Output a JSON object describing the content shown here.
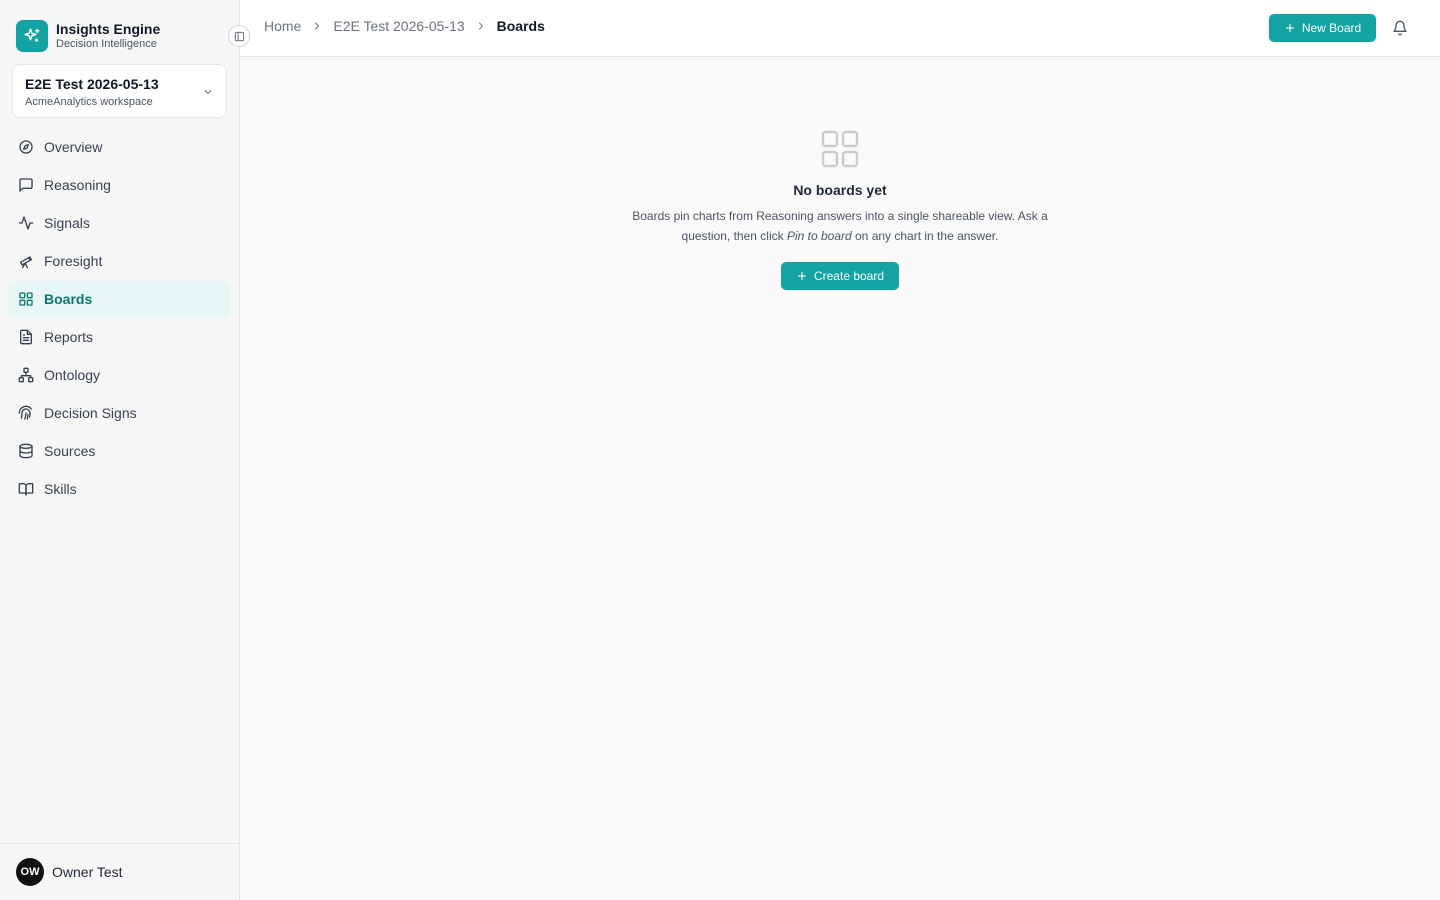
{
  "brand": {
    "title": "Insights Engine",
    "subtitle": "Decision Intelligence",
    "icon": "sparkle-icon",
    "color": "#14a3a3"
  },
  "workspace": {
    "name": "E2E Test 2026-05-13",
    "subtitle": "AcmeAnalytics workspace"
  },
  "nav": {
    "active": "Boards",
    "items": [
      {
        "label": "Overview",
        "icon": "compass-icon"
      },
      {
        "label": "Reasoning",
        "icon": "message-square-icon"
      },
      {
        "label": "Signals",
        "icon": "activity-icon"
      },
      {
        "label": "Foresight",
        "icon": "telescope-icon"
      },
      {
        "label": "Boards",
        "icon": "grid-icon"
      },
      {
        "label": "Reports",
        "icon": "file-text-icon"
      },
      {
        "label": "Ontology",
        "icon": "network-icon"
      },
      {
        "label": "Decision Signs",
        "icon": "fingerprint-icon"
      },
      {
        "label": "Sources",
        "icon": "database-icon"
      },
      {
        "label": "Skills",
        "icon": "book-open-icon"
      }
    ]
  },
  "user": {
    "initials": "OW",
    "name": "Owner Test"
  },
  "breadcrumb": {
    "home": "Home",
    "workspace": "E2E Test 2026-05-13",
    "current": "Boards"
  },
  "header": {
    "new_board_label": "New Board"
  },
  "empty_state": {
    "title": "No boards yet",
    "desc_before": "Boards pin charts from Reasoning answers into a single shareable view. Ask a question, then click ",
    "desc_em": "Pin to board",
    "desc_after": " on any chart in the answer.",
    "button_label": "Create board"
  },
  "colors": {
    "accent": "#14a3a3",
    "active_bg": "#e6f7f5",
    "active_text": "#0f766e"
  }
}
